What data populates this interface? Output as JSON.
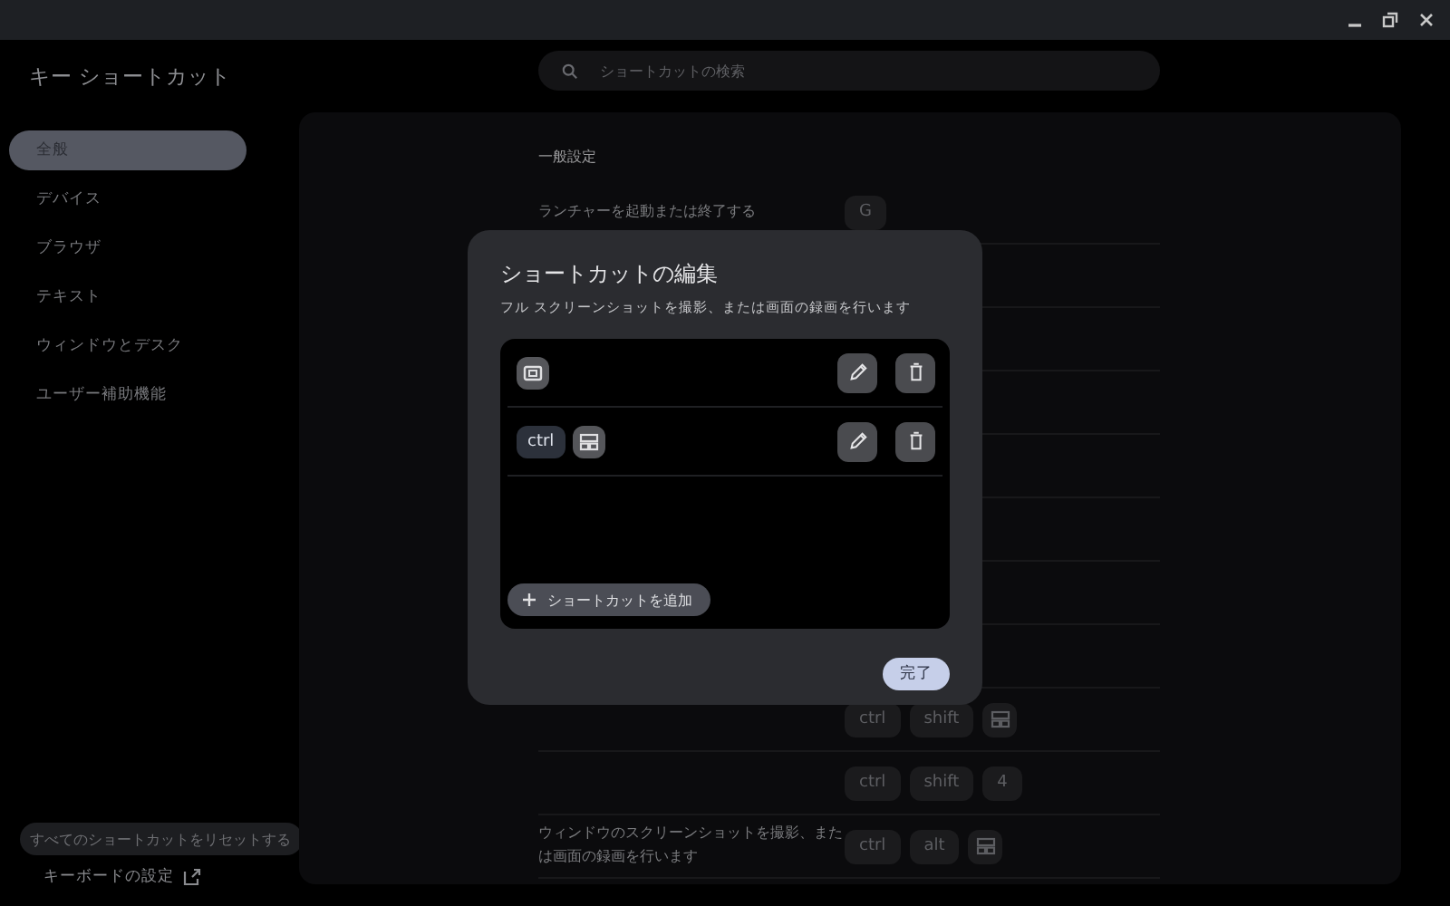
{
  "app_title": "キー ショートカット",
  "search": {
    "placeholder": "ショートカットの検索"
  },
  "sidebar": {
    "items": [
      {
        "label": "全般",
        "selected": true
      },
      {
        "label": "デバイス",
        "selected": false
      },
      {
        "label": "ブラウザ",
        "selected": false
      },
      {
        "label": "テキスト",
        "selected": false
      },
      {
        "label": "ウィンドウとデスク",
        "selected": false
      },
      {
        "label": "ユーザー補助機能",
        "selected": false
      }
    ]
  },
  "reset_button": "すべてのショートカットをリセットする",
  "keyboard_settings_link": "キーボードの設定",
  "content": {
    "section_title": "一般設定",
    "top_rows": [
      {
        "label": "ランチャーを起動または終了する",
        "keys": [
          {
            "kind": "key",
            "label": "G"
          }
        ]
      }
    ],
    "bottom_rows": [
      {
        "keys": [
          {
            "kind": "modifier",
            "label": "ctrl"
          },
          {
            "kind": "modifier",
            "label": "shift"
          },
          {
            "kind": "overview-key"
          }
        ]
      },
      {
        "keys": [
          {
            "kind": "modifier",
            "label": "ctrl"
          },
          {
            "kind": "modifier",
            "label": "shift"
          },
          {
            "kind": "key",
            "label": "4"
          }
        ]
      },
      {
        "label": "ウィンドウのスクリーンショットを撮影、または画面の録画を行います",
        "keys": [
          {
            "kind": "modifier",
            "label": "ctrl"
          },
          {
            "kind": "modifier",
            "label": "alt"
          },
          {
            "kind": "overview-key"
          }
        ]
      }
    ]
  },
  "dialog": {
    "title": "ショートカットの編集",
    "description": "フル スクリーンショットを撮影、または画面の録画を行います",
    "shortcuts": [
      {
        "keys": [
          {
            "kind": "screenshot-key"
          }
        ]
      },
      {
        "keys": [
          {
            "kind": "modifier",
            "label": "ctrl"
          },
          {
            "kind": "overview-key"
          }
        ]
      }
    ],
    "add_button": "ショートカットを追加",
    "done_button": "完了"
  }
}
